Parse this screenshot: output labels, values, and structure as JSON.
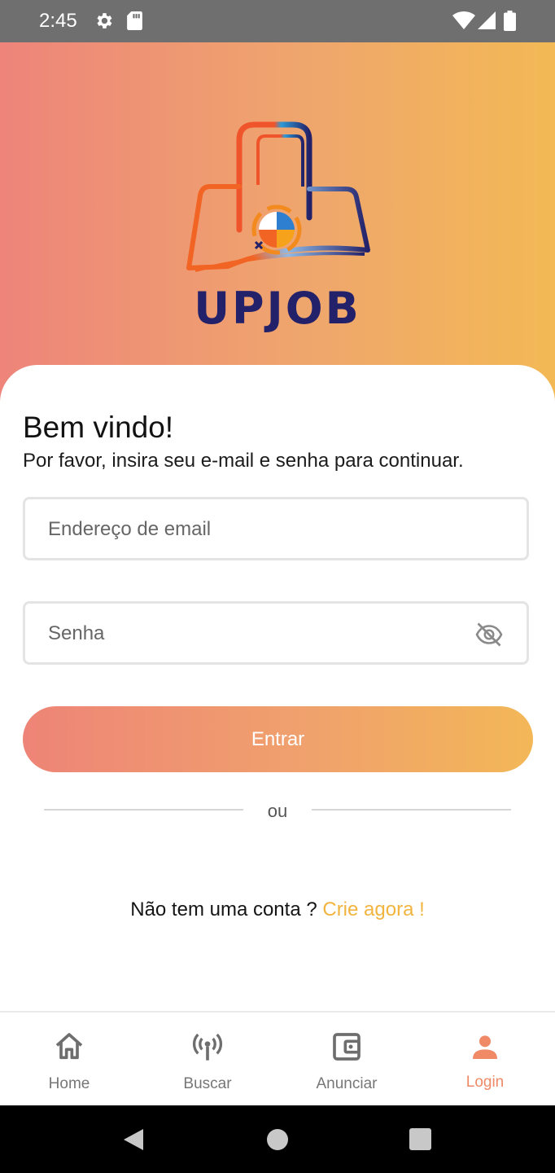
{
  "status_bar": {
    "time": "2:45",
    "icons": [
      "settings-gear-icon",
      "sd-card-icon",
      "wifi-icon",
      "signal-icon",
      "battery-icon"
    ]
  },
  "hero": {
    "brand_name": "UPJOB",
    "logo_icon": "shopping-bag-logo-icon",
    "gradient": [
      "#ee847a",
      "#f3b955"
    ]
  },
  "login": {
    "title": "Bem vindo!",
    "subtitle": "Por favor, insira seu e-mail e senha para continuar.",
    "email_placeholder": "Endereço de email",
    "email_value": "",
    "password_placeholder": "Senha",
    "password_value": "",
    "password_toggle_icon": "eye-off-icon",
    "submit_label": "Entrar",
    "or_label": "ou",
    "signup_prompt": "Não tem uma conta ?",
    "signup_link": "Crie agora !"
  },
  "bottom_nav": {
    "items": [
      {
        "label": "Home",
        "icon": "home-icon",
        "active": false
      },
      {
        "label": "Buscar",
        "icon": "broadcast-antenna-icon",
        "active": false
      },
      {
        "label": "Anunciar",
        "icon": "wallet-icon",
        "active": false
      },
      {
        "label": "Login",
        "icon": "person-icon",
        "active": true
      }
    ]
  },
  "colors": {
    "accent": "#ef8966",
    "link": "#f1b43f",
    "brand_text": "#232169",
    "nav_inactive": "#777777"
  },
  "system_nav": {
    "buttons": [
      "back-icon",
      "home-circle-icon",
      "recents-icon"
    ]
  }
}
